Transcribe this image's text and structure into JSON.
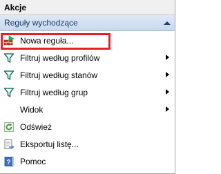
{
  "pane": {
    "title": "Akcje"
  },
  "section": {
    "title": "Reguły wychodzące"
  },
  "items": [
    {
      "label": "Nowa reguła...",
      "icon": "new-rule-icon",
      "submenu": false
    },
    {
      "label": "Filtruj według profilów",
      "icon": "filter-icon",
      "submenu": true
    },
    {
      "label": "Filtruj według stanów",
      "icon": "filter-icon",
      "submenu": true
    },
    {
      "label": "Filtruj według grup",
      "icon": "filter-icon",
      "submenu": true
    },
    {
      "label": "Widok",
      "icon": "",
      "submenu": true
    },
    {
      "label": "Odśwież",
      "icon": "refresh-icon",
      "submenu": false
    },
    {
      "label": "Eksportuj listę...",
      "icon": "export-list-icon",
      "submenu": false
    },
    {
      "label": "Pomoc",
      "icon": "help-icon",
      "submenu": false
    }
  ],
  "colors": {
    "highlight": "#e3202b",
    "section_text": "#1a3a6e",
    "filter_icon": "#1a7a6a"
  }
}
